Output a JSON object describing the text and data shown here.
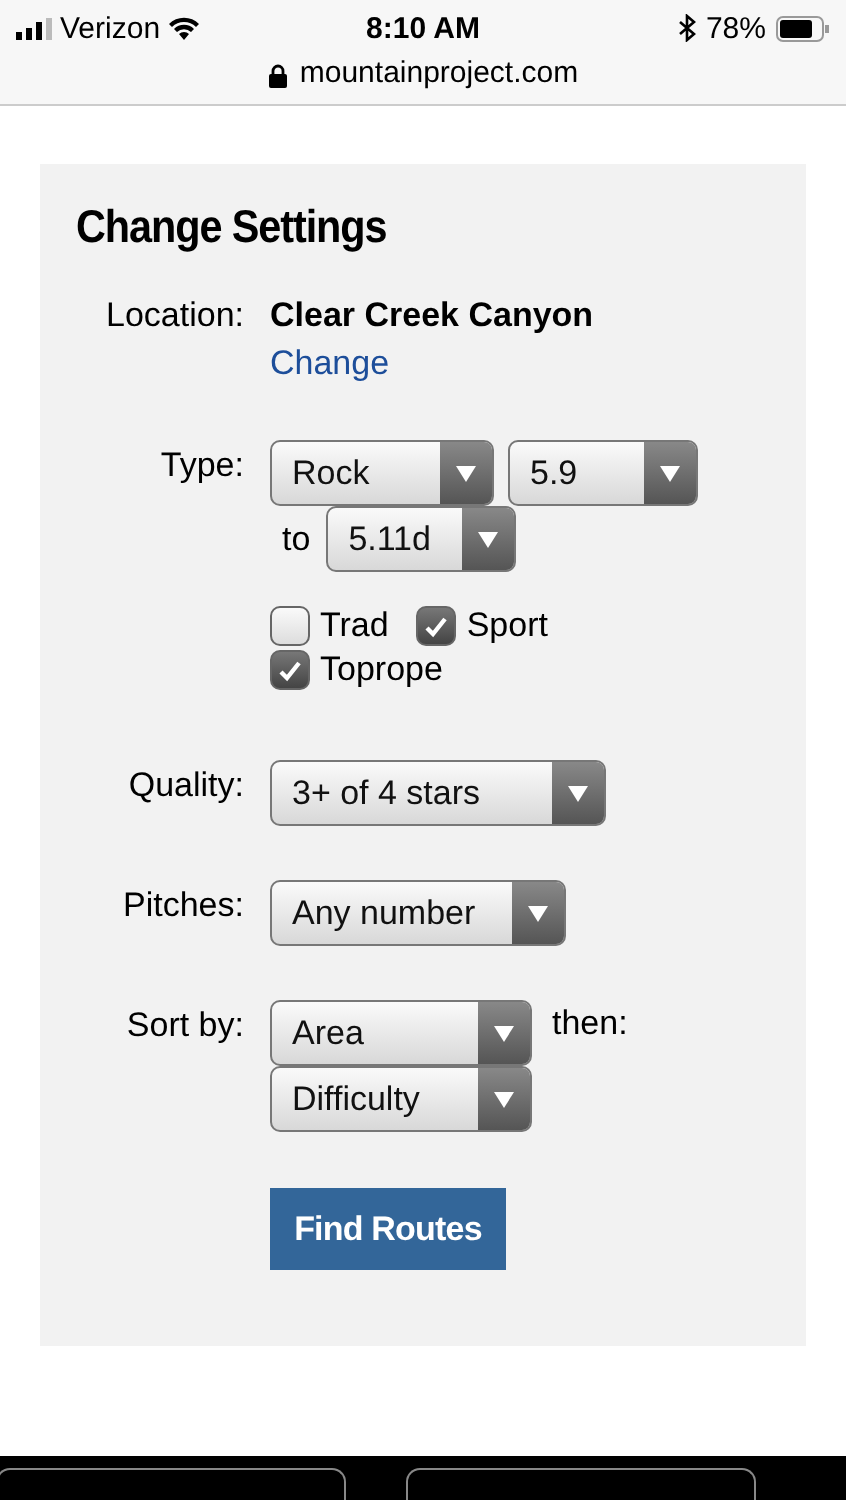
{
  "status_bar": {
    "carrier": "Verizon",
    "time": "8:10 AM",
    "battery": "78%"
  },
  "address_bar": {
    "url": "mountainproject.com"
  },
  "settings": {
    "title": "Change Settings",
    "location": {
      "label": "Location:",
      "value": "Clear Creek Canyon",
      "link": "Change"
    },
    "type": {
      "label": "Type:",
      "selects": [
        "Rock",
        "5.9"
      ],
      "to_label": "to",
      "to_select": "5.11d"
    },
    "checkboxes": [
      {
        "label": "Trad",
        "checked": false
      },
      {
        "label": "Sport",
        "checked": true
      },
      {
        "label": "Toprope",
        "checked": true
      }
    ],
    "quality": {
      "label": "Quality:",
      "select": "3+ of 4 stars"
    },
    "pitches": {
      "label": "Pitches:",
      "select": "Any number"
    },
    "sort": {
      "label": "Sort by:",
      "select": "Area",
      "then_label": "then:",
      "then_select": "Difficulty"
    },
    "button": "Find Routes"
  }
}
